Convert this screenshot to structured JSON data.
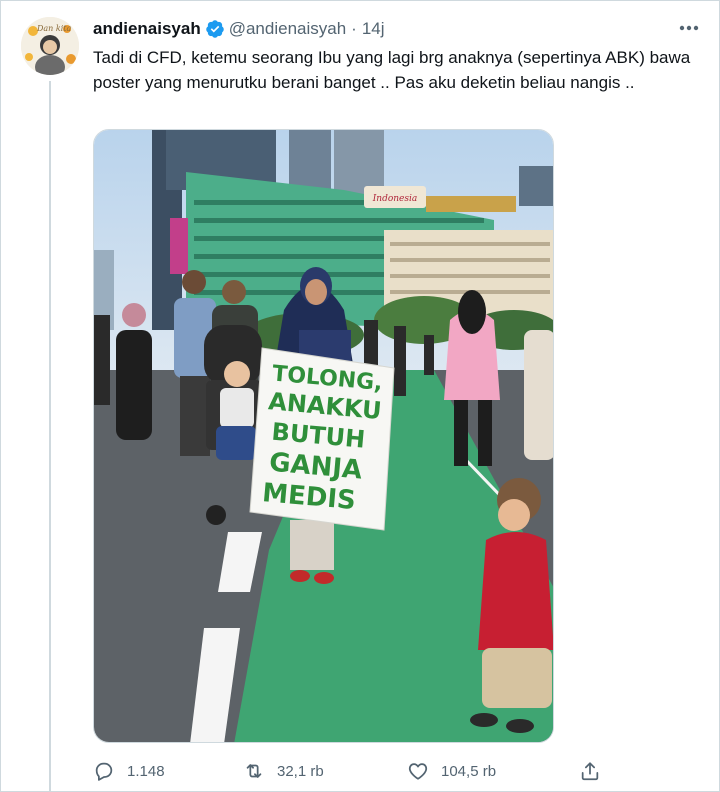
{
  "tweet": {
    "author_name": "andienaisyah",
    "author_handle": "@andienaisyah",
    "separator": "·",
    "time": "14j",
    "text": "Tadi di CFD, ketemu seorang Ibu yang lagi brg anaknya (sepertinya ABK) bawa poster yang menurutku berani banget .. Pas aku deketin beliau nangis ..",
    "avatar_text": "Dan kita"
  },
  "media": {
    "sign_lines": [
      "TOLONG,",
      "ANAKKU",
      "BUTUH",
      "GANJA",
      "MEDIS"
    ],
    "hotel_sign": "Indonesia"
  },
  "actions": {
    "reply": {
      "icon": "reply-icon",
      "count": "1.148"
    },
    "retweet": {
      "icon": "retweet-icon",
      "count": "32,1 rb"
    },
    "like": {
      "icon": "heart-icon",
      "count": "104,5 rb"
    },
    "share": {
      "icon": "share-icon"
    }
  },
  "colors": {
    "verified": "#1d9bf0",
    "muted": "#536471",
    "border": "#cfd9de"
  }
}
